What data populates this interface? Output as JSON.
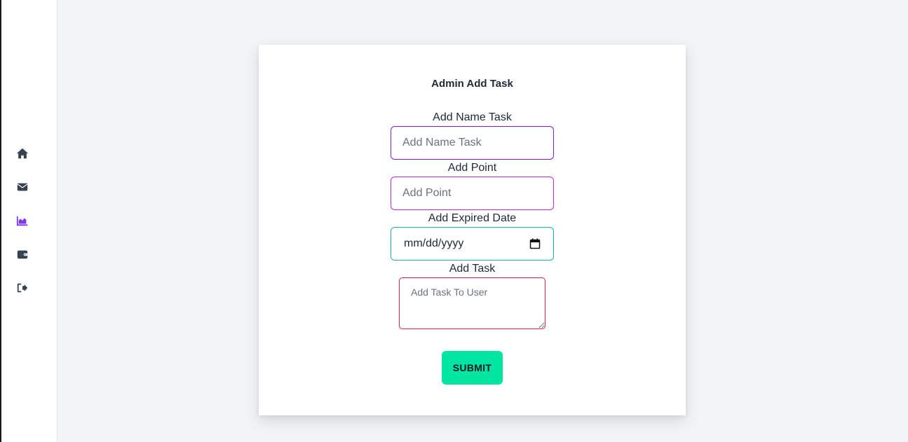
{
  "sidebar": {
    "items": [
      {
        "name": "home",
        "icon": "home-icon",
        "color": "#374151",
        "active": false
      },
      {
        "name": "mail",
        "icon": "envelope-icon",
        "color": "#374151",
        "active": false
      },
      {
        "name": "analytics",
        "icon": "chart-area-icon",
        "color": "#7c3aed",
        "active": true
      },
      {
        "name": "wallet",
        "icon": "wallet-icon",
        "color": "#374151",
        "active": false
      },
      {
        "name": "logout",
        "icon": "sign-out-icon",
        "color": "#374151",
        "active": false
      }
    ]
  },
  "form": {
    "title": "Admin Add Task",
    "name_label": "Add Name Task",
    "name_placeholder": "Add Name Task",
    "name_value": "",
    "point_label": "Add Point",
    "point_placeholder": "Add Point",
    "point_value": "",
    "date_label": "Add Expired Date",
    "date_value": "mm/dd/yyyy",
    "task_label": "Add Task",
    "task_placeholder": "Add Task To User",
    "task_value": "",
    "submit_label": "SUBMIT"
  },
  "colors": {
    "name_border": "#7e22ce",
    "point_border": "#c026d3",
    "date_border": "#14b8a6",
    "task_border": "#e11d48",
    "submit_bg": "#00e6a0",
    "active_nav": "#7c3aed"
  }
}
